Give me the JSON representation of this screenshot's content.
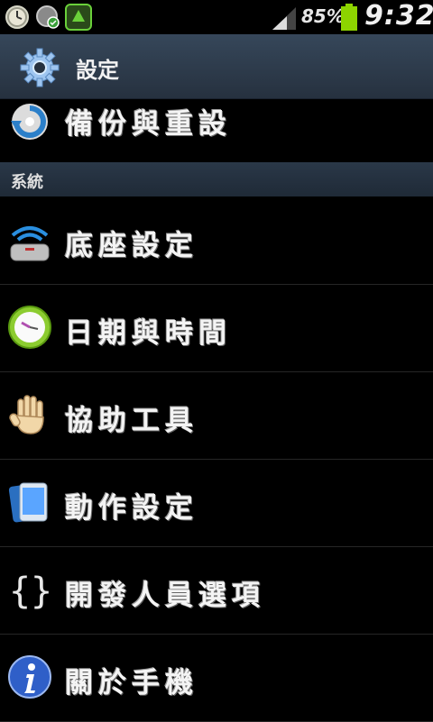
{
  "status_bar": {
    "battery_percent": "85%",
    "time": "9:32"
  },
  "title_bar": {
    "title": "設定",
    "icon": "gear-icon"
  },
  "top_item": {
    "label": "備份與重設",
    "icon": "backup-reset-icon"
  },
  "section": {
    "label": "系統"
  },
  "items": [
    {
      "label": "底座設定",
      "icon": "dock-icon"
    },
    {
      "label": "日期與時間",
      "icon": "clock-icon"
    },
    {
      "label": "協助工具",
      "icon": "hand-icon"
    },
    {
      "label": "動作設定",
      "icon": "motion-phone-icon"
    },
    {
      "label": "開發人員選項",
      "icon": "braces-icon"
    },
    {
      "label": "關於手機",
      "icon": "info-icon"
    }
  ],
  "colors": {
    "background": "#000000",
    "title_bar": "#2f3d4d",
    "battery": "#8dd400",
    "section_header": "#243140"
  }
}
